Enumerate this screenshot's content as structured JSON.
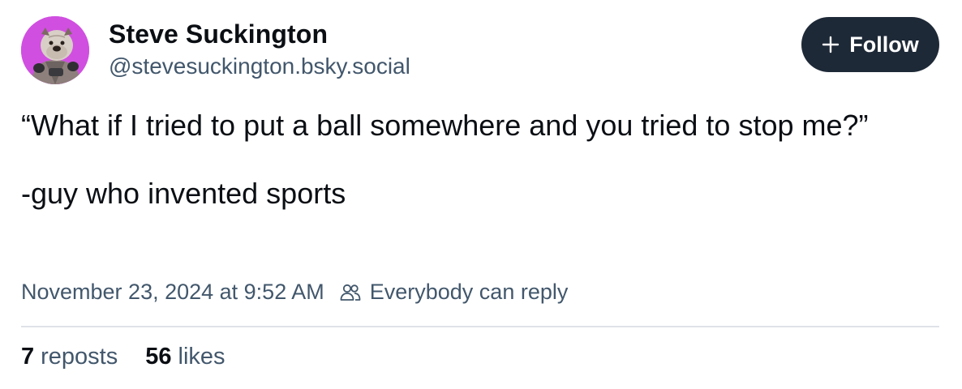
{
  "author": {
    "display_name": "Steve Suckington",
    "handle": "@stevesuckington.bsky.social",
    "avatar_icon": "bulldog-avatar"
  },
  "follow_button": {
    "label": "Follow",
    "icon": "plus-icon"
  },
  "post": {
    "lines": [
      "“What if I tried to put a ball somewhere and you tried to stop me?”",
      "-guy who invented sports"
    ],
    "timestamp": "November 23, 2024 at 9:52 AM",
    "reply_setting_icon": "people-icon",
    "reply_setting": "Everybody can reply"
  },
  "stats": {
    "reposts": {
      "count": "7",
      "label": "reposts"
    },
    "likes": {
      "count": "56",
      "label": "likes"
    }
  },
  "colors": {
    "text_primary": "#0b0f14",
    "text_secondary": "#42576c",
    "button_bg": "#1e2937",
    "avatar_bg": "#d04fe0",
    "divider": "#dfe3e8"
  }
}
